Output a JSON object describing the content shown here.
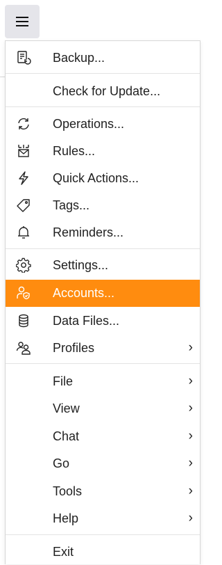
{
  "accent_color": "#ff8c0f",
  "hamburger": {
    "icon": "hamburger-menu-icon"
  },
  "menu": {
    "items": [
      {
        "label": "Backup...",
        "icon": "backup-icon"
      },
      {
        "label": "Check for Update..."
      },
      {
        "label": "Operations...",
        "icon": "sync-icon"
      },
      {
        "label": "Rules...",
        "icon": "rules-icon"
      },
      {
        "label": "Quick Actions...",
        "icon": "lightning-icon"
      },
      {
        "label": "Tags...",
        "icon": "tag-icon"
      },
      {
        "label": "Reminders...",
        "icon": "bell-icon"
      },
      {
        "label": "Settings...",
        "icon": "gear-icon"
      },
      {
        "label": "Accounts...",
        "icon": "account-shield-icon",
        "selected": true
      },
      {
        "label": "Data Files...",
        "icon": "database-icon"
      },
      {
        "label": "Profiles",
        "icon": "profiles-icon",
        "submenu": true
      },
      {
        "label": "File",
        "submenu": true
      },
      {
        "label": "View",
        "submenu": true
      },
      {
        "label": "Chat",
        "submenu": true
      },
      {
        "label": "Go",
        "submenu": true
      },
      {
        "label": "Tools",
        "submenu": true
      },
      {
        "label": "Help",
        "submenu": true
      },
      {
        "label": "Exit"
      }
    ],
    "submenu_glyph": "›"
  }
}
